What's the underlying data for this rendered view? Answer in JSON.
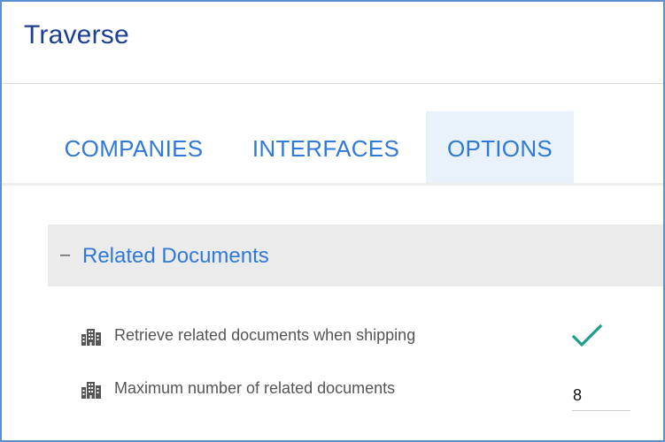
{
  "app": {
    "title": "Traverse"
  },
  "tabs": [
    {
      "label": "COMPANIES",
      "active": false
    },
    {
      "label": "INTERFACES",
      "active": false
    },
    {
      "label": "OPTIONS",
      "active": true
    }
  ],
  "section": {
    "toggle": "–",
    "title": "Related Documents",
    "expanded": true
  },
  "options": [
    {
      "label": "Retrieve related documents when shipping",
      "type": "checkbox",
      "checked": true,
      "icon": "building-icon"
    },
    {
      "label": "Maximum number of related documents",
      "type": "number",
      "value": "8",
      "icon": "building-icon"
    }
  ],
  "colors": {
    "frame_border": "#5b8fd0",
    "title": "#1c3f94",
    "accent": "#2f7ad9",
    "active_tab_bg": "#e9f2fb",
    "section_bg": "#ebebeb",
    "check": "#1aa08a",
    "icon": "#555555"
  }
}
